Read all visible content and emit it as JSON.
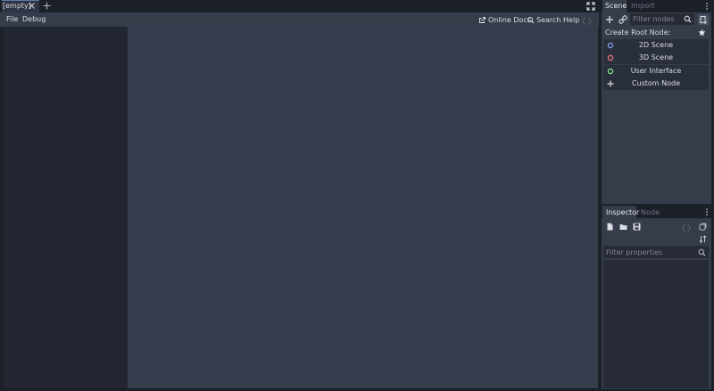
{
  "top_tabs": {
    "active_tab": "[empty]",
    "close_icon": "close-icon",
    "add_icon": "plus-icon",
    "fullscreen_icon": "expand-icon"
  },
  "script_menu": {
    "file": "File",
    "debug": "Debug",
    "online_docs": "Online Docs",
    "search_help": "Search Help",
    "back": "〈",
    "forward": "〉"
  },
  "scene_dock": {
    "tabs": [
      "Scene",
      "Import"
    ],
    "filter_placeholder": "Filter nodes",
    "create_root_label": "Create Root Node:",
    "root_options": [
      {
        "label": "2D Scene",
        "icon": "node2d-icon",
        "color": "#8da5f3"
      },
      {
        "label": "3D Scene",
        "icon": "node3d-icon",
        "color": "#fc7f7f"
      },
      {
        "label": "User Interface",
        "icon": "control-icon",
        "color": "#8eef97"
      },
      {
        "label": "Custom Node",
        "icon": "plus-icon",
        "color": "#e0e0e0"
      }
    ]
  },
  "inspector_dock": {
    "tabs": [
      "Inspector",
      "Node"
    ],
    "back": "〈",
    "forward": "〉",
    "filter_placeholder": "Filter properties"
  },
  "colors": {
    "accent": "#5c7aa8",
    "panel": "#363d4a",
    "background": "#1c2029"
  }
}
